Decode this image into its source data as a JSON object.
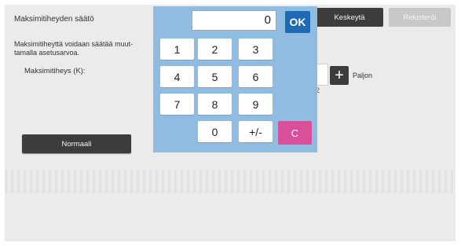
{
  "page": {
    "title": "Maksimitiheyden säätö",
    "description": "Maksimitiheyttä voidaan säätää muut-tamalla asetusarvoa.",
    "field_label": "Maksimitiheys (K):",
    "normal_button": "Normaali",
    "stop_button": "Keskeytä",
    "register_button": "Rekisteröi",
    "plus_symbol": "+",
    "plus_label": "Paljon",
    "stray_mark": "2"
  },
  "keypad": {
    "display_value": "0",
    "ok_label": "OK",
    "keys": [
      "1",
      "2",
      "3",
      "4",
      "5",
      "6",
      "7",
      "8",
      "9",
      "0",
      "+/-"
    ],
    "clear_label": "C"
  },
  "colors": {
    "keypad_bg": "#8fbce0",
    "ok": "#1f6ab5",
    "clear": "#d94f9a",
    "dark_button": "#3c3c3c",
    "disabled_button": "#c8c8c8"
  }
}
